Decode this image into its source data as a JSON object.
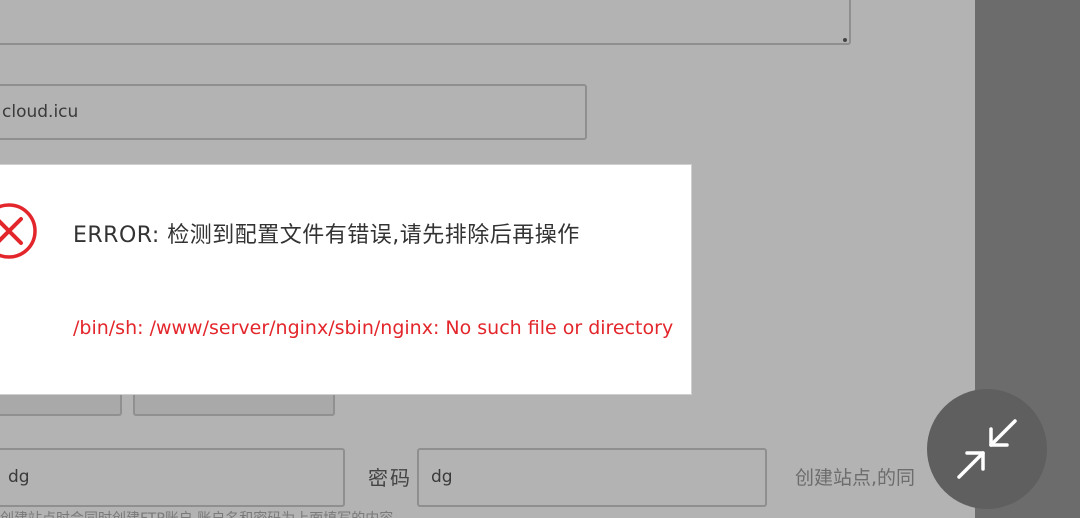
{
  "form": {
    "domain_value": "cloud.icu",
    "ftp_user_value": "dg",
    "password_label": "密码",
    "password_value": "dg",
    "hint_text": "创建站点,的同",
    "bottom_faint_text": "创建站点时会同时创建FTP账户,账户名和密码为上面填写的内容"
  },
  "dialog": {
    "title": "ERROR: 检测到配置文件有错误,请先排除后再操作",
    "detail": "/bin/sh: /www/server/nginx/sbin/nginx: No such file or directory",
    "icon": "error-x-circle-icon",
    "accent_color": "#e3262b"
  },
  "fab": {
    "icon": "collapse-arrows-icon"
  }
}
